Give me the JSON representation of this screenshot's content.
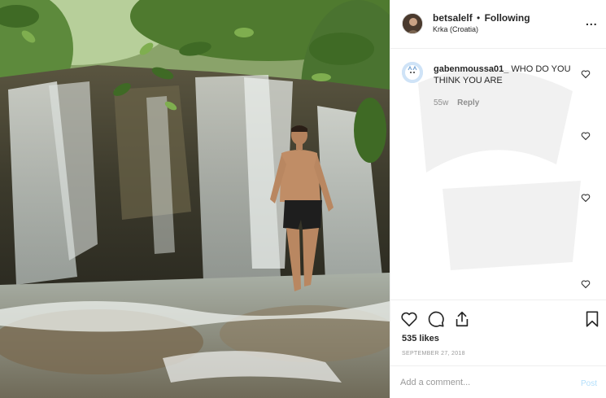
{
  "post": {
    "username": "betsalelf",
    "separator": "•",
    "follow_status": "Following",
    "location": "Krka (Croatia)",
    "more_glyph": "..."
  },
  "comments": [
    {
      "username": "gabenmoussa01_",
      "text": "WHO DO YOU THINK YOU ARE",
      "age": "55w",
      "reply_label": "Reply"
    }
  ],
  "likes": "535 likes",
  "date": "September 27, 2018",
  "add_comment": {
    "placeholder": "Add a comment...",
    "post_label": "Post"
  },
  "icons": {
    "like": "heart-icon",
    "comment": "speech-bubble-icon",
    "share": "share-icon",
    "save": "bookmark-icon",
    "comment_like": "small-heart-icon",
    "more": "ellipsis-icon"
  },
  "colors": {
    "text": "#262626",
    "muted": "#8e8e8e",
    "border": "#efefef",
    "post_disabled": "#b2dffc"
  }
}
